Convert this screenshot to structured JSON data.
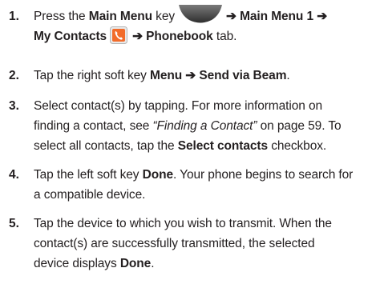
{
  "steps": [
    {
      "number": "1.",
      "t1": "Press the ",
      "b1": "Main Menu",
      "t2": " key",
      "icon1": "main-menu-key-icon",
      "b2": "➔ Main Menu 1 ➔",
      "b3": "My Contacts",
      "icon2": "contacts-app-icon",
      "b4": "➔ Phonebook",
      "t3": " tab."
    },
    {
      "number": "2.",
      "t1": "Tap the right soft key  ",
      "b1": "Menu ➔ Send via Beam",
      "t2": "."
    },
    {
      "number": "3.",
      "l1": "Select contact(s) by tapping. For more information on",
      "l2a": "finding a contact, see ",
      "l2i": "“Finding a Contact”",
      "l2b": " on page 59. To",
      "l3a": "select all contacts, tap the ",
      "l3b": "Select contacts",
      "l3c": " checkbox."
    },
    {
      "number": "4.",
      "l1a": "Tap the left soft key ",
      "l1b": "Done",
      "l1c": ". Your phone begins to search for",
      "l2": "a compatible device."
    },
    {
      "number": "5.",
      "l1": "Tap the device to which you wish to transmit. When the",
      "l2": "contact(s) are successfully transmitted, the selected",
      "l3a": "device displays ",
      "l3b": "Done",
      "l3c": "."
    }
  ],
  "colors": {
    "text": "#231f20",
    "icon_dark": "#3a3a3a",
    "contacts_orange": "#f26c2b"
  }
}
